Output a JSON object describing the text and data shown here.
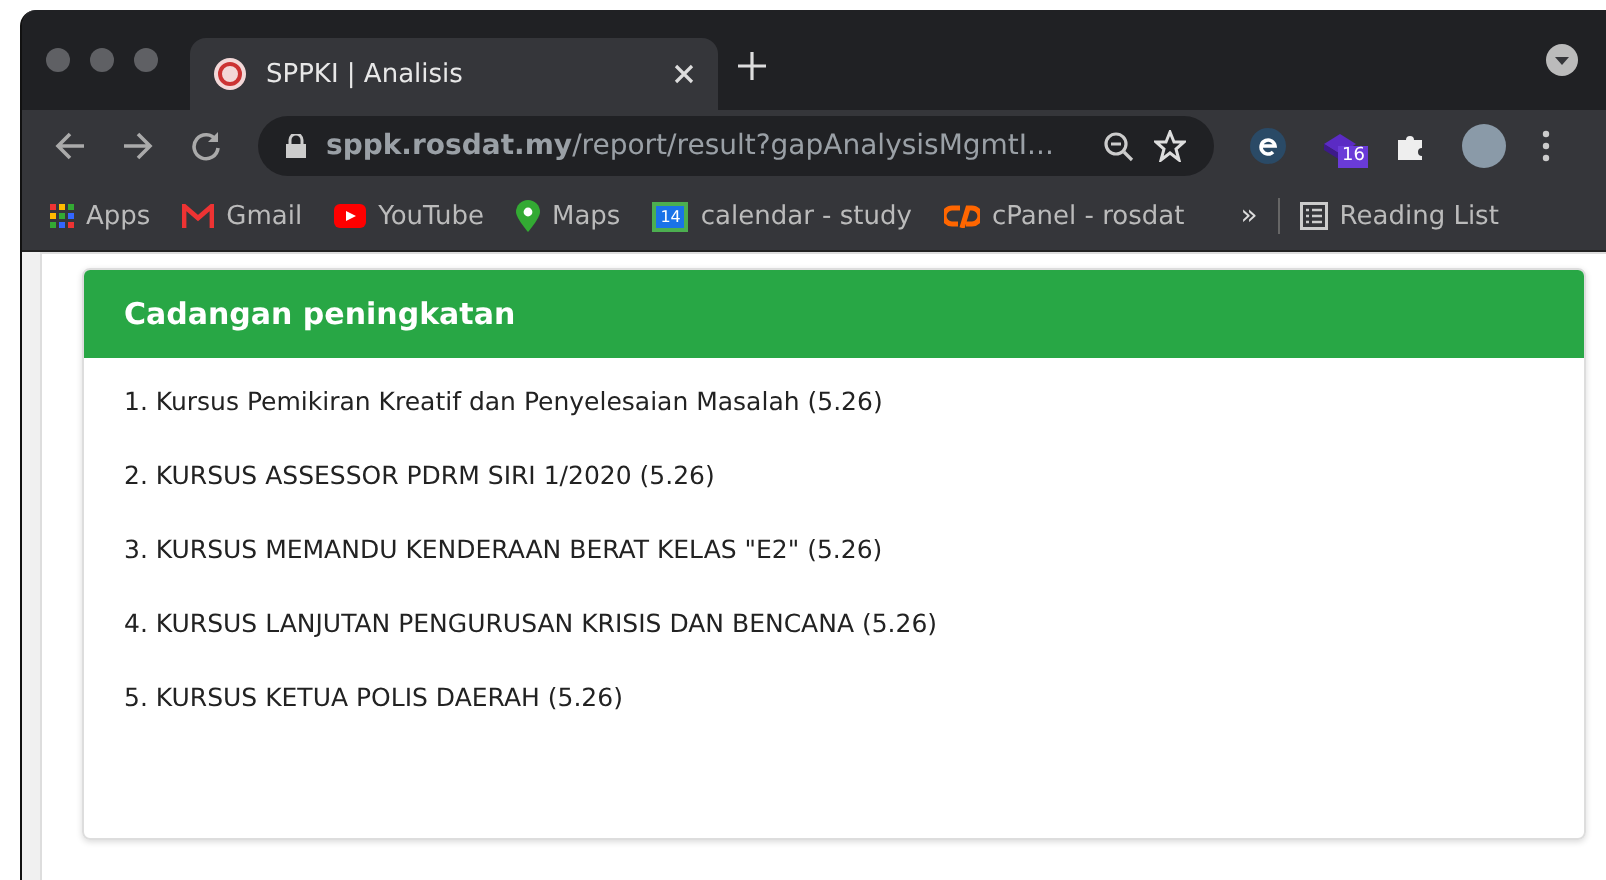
{
  "tab": {
    "title": "SPPKI | Analisis",
    "selected": true
  },
  "address": {
    "url": "**sppk.rosdat.my**/report/result?gapAnalysisMgmtI..."
  },
  "extension_badge": "16",
  "bookmarks": [
    {
      "kind": "apps",
      "label": "Apps"
    },
    {
      "kind": "gmail",
      "label": "Gmail"
    },
    {
      "kind": "youtube",
      "label": "YouTube"
    },
    {
      "kind": "maps",
      "label": "Maps"
    },
    {
      "kind": "calendar",
      "label": "calendar - study",
      "icon_text": "14"
    },
    {
      "kind": "cpanel",
      "label": "cPanel - rosdat"
    }
  ],
  "overflow": "»",
  "reading_list": "Reading List",
  "card": {
    "title": "Cadangan peningkatan",
    "items": [
      "1. Kursus Pemikiran Kreatif dan Penyelesaian Masalah (5.26)",
      "2. KURSUS ASSESSOR PDRM SIRI 1/2020 (5.26)",
      "3. KURSUS MEMANDU KENDERAAN BERAT KELAS \"E2\" (5.26)",
      "4. KURSUS LANJUTAN PENGURUSAN KRISIS DAN BENCANA (5.26)",
      "5. KURSUS KETUA POLIS DAERAH (5.26)"
    ]
  }
}
